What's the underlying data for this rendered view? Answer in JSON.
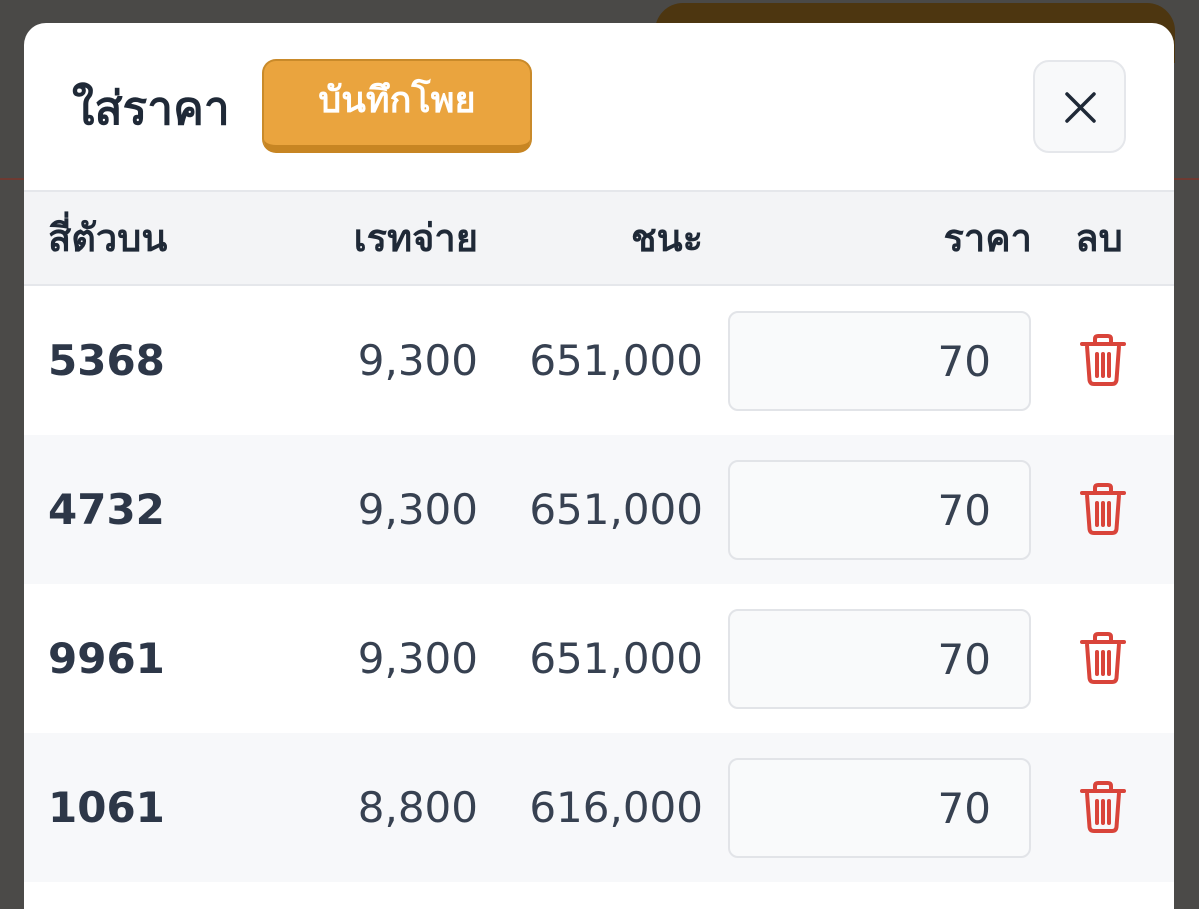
{
  "modal": {
    "title": "ใส่ราคา",
    "save_button_label": "บันทึกโพย",
    "close_icon": "close-icon"
  },
  "table": {
    "headers": {
      "number": "สี่ตัวบน",
      "rate": "เรทจ่าย",
      "win": "ชนะ",
      "price": "ราคา",
      "delete": "ลบ"
    },
    "rows": [
      {
        "number": "5368",
        "rate": "9,300",
        "win": "651,000",
        "price": "70"
      },
      {
        "number": "4732",
        "rate": "9,300",
        "win": "651,000",
        "price": "70"
      },
      {
        "number": "9961",
        "rate": "9,300",
        "win": "651,000",
        "price": "70"
      },
      {
        "number": "1061",
        "rate": "8,800",
        "win": "616,000",
        "price": "70"
      }
    ],
    "delete_icon": "trash-icon"
  },
  "colors": {
    "accent": "#eaa43e",
    "delete": "#d9443a",
    "text": "#1f2937"
  }
}
